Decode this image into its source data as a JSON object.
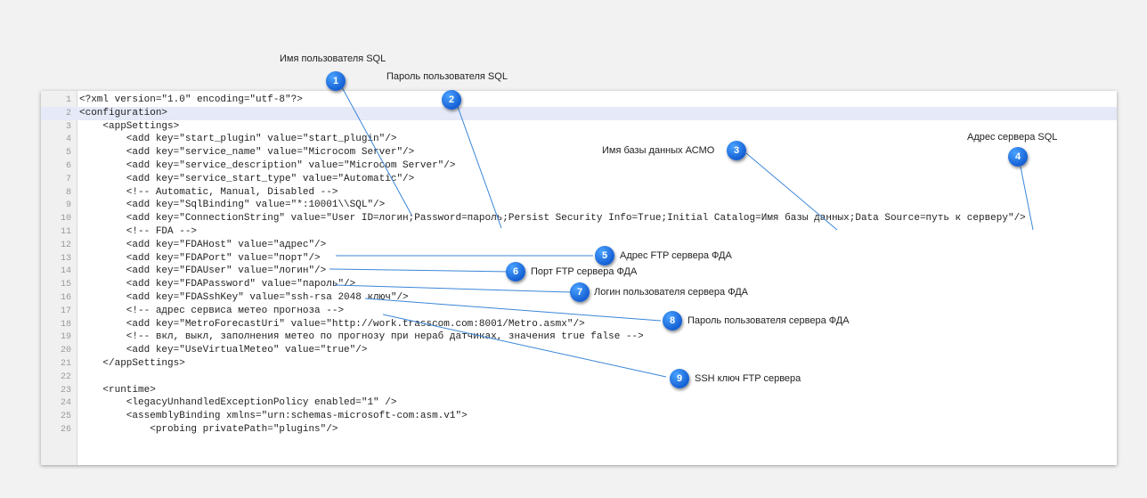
{
  "callouts": [
    {
      "num": "1",
      "label": "Имя пользователя SQL"
    },
    {
      "num": "2",
      "label": "Пароль пользователя SQL"
    },
    {
      "num": "3",
      "label": "Имя базы данных АСМО"
    },
    {
      "num": "4",
      "label": "Адрес сервера SQL"
    },
    {
      "num": "5",
      "label": "Адрес FTP сервера ФДА"
    },
    {
      "num": "6",
      "label": "Порт FTP сервера ФДА"
    },
    {
      "num": "7",
      "label": "Логин пользователя сервера ФДА"
    },
    {
      "num": "8",
      "label": "Пароль пользователя сервера ФДА"
    },
    {
      "num": "9",
      "label": "SSH ключ FTP сервера"
    }
  ],
  "editor": {
    "highlighted_line": 2,
    "lines": [
      {
        "n": "1",
        "code": "<?xml version=\"1.0\" encoding=\"utf-8\"?>"
      },
      {
        "n": "2",
        "code": "<configuration>"
      },
      {
        "n": "3",
        "code": "    <appSettings>"
      },
      {
        "n": "4",
        "code": "        <add key=\"start_plugin\" value=\"start_plugin\"/>"
      },
      {
        "n": "5",
        "code": "        <add key=\"service_name\" value=\"Microcom Server\"/>"
      },
      {
        "n": "6",
        "code": "        <add key=\"service_description\" value=\"Microcom Server\"/>"
      },
      {
        "n": "7",
        "code": "        <add key=\"service_start_type\" value=\"Automatic\"/>"
      },
      {
        "n": "8",
        "code": "        <!-- Automatic, Manual, Disabled -->"
      },
      {
        "n": "9",
        "code": "        <add key=\"SqlBinding\" value=\"*:10001\\\\SQL\"/>"
      },
      {
        "n": "10",
        "code": "        <add key=\"ConnectionString\" value=\"User ID=логин;Password=пароль;Persist Security Info=True;Initial Catalog=Имя базы данных;Data Source=путь к серверу\"/>"
      },
      {
        "n": "11",
        "code": "        <!-- FDA -->"
      },
      {
        "n": "12",
        "code": "        <add key=\"FDAHost\" value=\"адрес\"/>"
      },
      {
        "n": "13",
        "code": "        <add key=\"FDAPort\" value=\"порт\"/>"
      },
      {
        "n": "14",
        "code": "        <add key=\"FDAUser\" value=\"логин\"/>"
      },
      {
        "n": "15",
        "code": "        <add key=\"FDAPassword\" value=\"пароль\"/>"
      },
      {
        "n": "16",
        "code": "        <add key=\"FDASshKey\" value=\"ssh-rsa 2048 ключ\"/>"
      },
      {
        "n": "17",
        "code": "        <!-- адрес сервиса метео прогноза -->"
      },
      {
        "n": "18",
        "code": "        <add key=\"MetroForecastUri\" value=\"http://work.trasscom.com:8001/Metro.asmx\"/>"
      },
      {
        "n": "19",
        "code": "        <!-- вкл, выкл, заполнения метео по прогнозу при нераб датчиках, значения true false -->"
      },
      {
        "n": "20",
        "code": "        <add key=\"UseVirtualMeteo\" value=\"true\"/>"
      },
      {
        "n": "21",
        "code": "    </appSettings>"
      },
      {
        "n": "22",
        "code": ""
      },
      {
        "n": "23",
        "code": "    <runtime>"
      },
      {
        "n": "24",
        "code": "        <legacyUnhandledExceptionPolicy enabled=\"1\" />"
      },
      {
        "n": "25",
        "code": "        <assemblyBinding xmlns=\"urn:schemas-microsoft-com:asm.v1\">"
      },
      {
        "n": "26",
        "code": "            <probing privatePath=\"plugins\"/>"
      }
    ]
  }
}
